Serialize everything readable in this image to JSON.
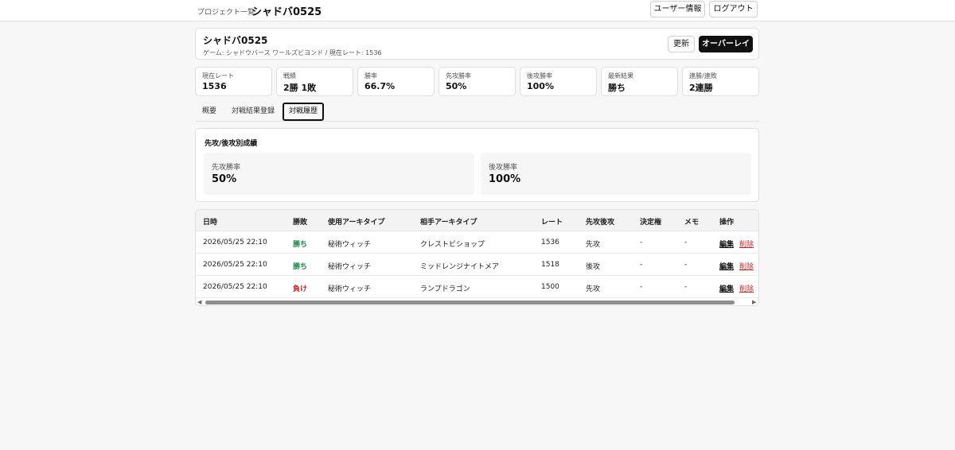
{
  "topbar": {
    "breadcrumb": "プロジェクト一覧",
    "title": "シャドバ0525",
    "user_info_label": "ユーザー情報",
    "logout_label": "ログアウト"
  },
  "header": {
    "title": "シャドバ0525",
    "subtitle": "ゲーム: シャドウバース ワールズビヨンド / 現在レート: 1536",
    "refresh_label": "更新",
    "overlay_label": "オーバーレイ"
  },
  "stats": [
    {
      "label": "現在レート",
      "value": "1536"
    },
    {
      "label": "戦績",
      "value": "2勝 1敗"
    },
    {
      "label": "勝率",
      "value": "66.7%"
    },
    {
      "label": "先攻勝率",
      "value": "50%"
    },
    {
      "label": "後攻勝率",
      "value": "100%"
    },
    {
      "label": "最新結果",
      "value": "勝ち"
    },
    {
      "label": "連勝/連敗",
      "value": "2連勝"
    }
  ],
  "tabs": [
    {
      "label": "概要"
    },
    {
      "label": "対戦結果登録"
    },
    {
      "label": "対戦履歴",
      "active": true
    }
  ],
  "split": {
    "title": "先攻/後攻別成績",
    "first_label": "先攻勝率",
    "first_value": "50%",
    "second_label": "後攻勝率",
    "second_value": "100%"
  },
  "table": {
    "headers": [
      "日時",
      "勝敗",
      "使用アーキタイプ",
      "相手アーキタイプ",
      "レート",
      "先攻後攻",
      "決定権",
      "メモ",
      "操作"
    ],
    "rows": [
      {
        "date": "2026/05/25 22:10",
        "result": "勝ち",
        "win": true,
        "archetype": "秘術ウィッチ",
        "opponent": "クレストビショップ",
        "rate": "1536",
        "turn": "先攻",
        "decider": "-",
        "memo": "-",
        "edit": "編集",
        "delete": "削除"
      },
      {
        "date": "2026/05/25 22:10",
        "result": "勝ち",
        "win": true,
        "archetype": "秘術ウィッチ",
        "opponent": "ミッドレンジナイトメア",
        "rate": "1518",
        "turn": "後攻",
        "decider": "-",
        "memo": "-",
        "edit": "編集",
        "delete": "削除"
      },
      {
        "date": "2026/05/25 22:10",
        "result": "負け",
        "win": false,
        "archetype": "秘術ウィッチ",
        "opponent": "ランプドラゴン",
        "rate": "1500",
        "turn": "先攻",
        "decider": "-",
        "memo": "-",
        "edit": "編集",
        "delete": "削除"
      }
    ]
  },
  "icons": {
    "scroll_left": "scroll-left-arrow-icon",
    "scroll_right": "scroll-right-arrow-icon"
  },
  "colors": {
    "win": "#1a8a47",
    "lose": "#c62828",
    "primary_button": "#111111"
  }
}
